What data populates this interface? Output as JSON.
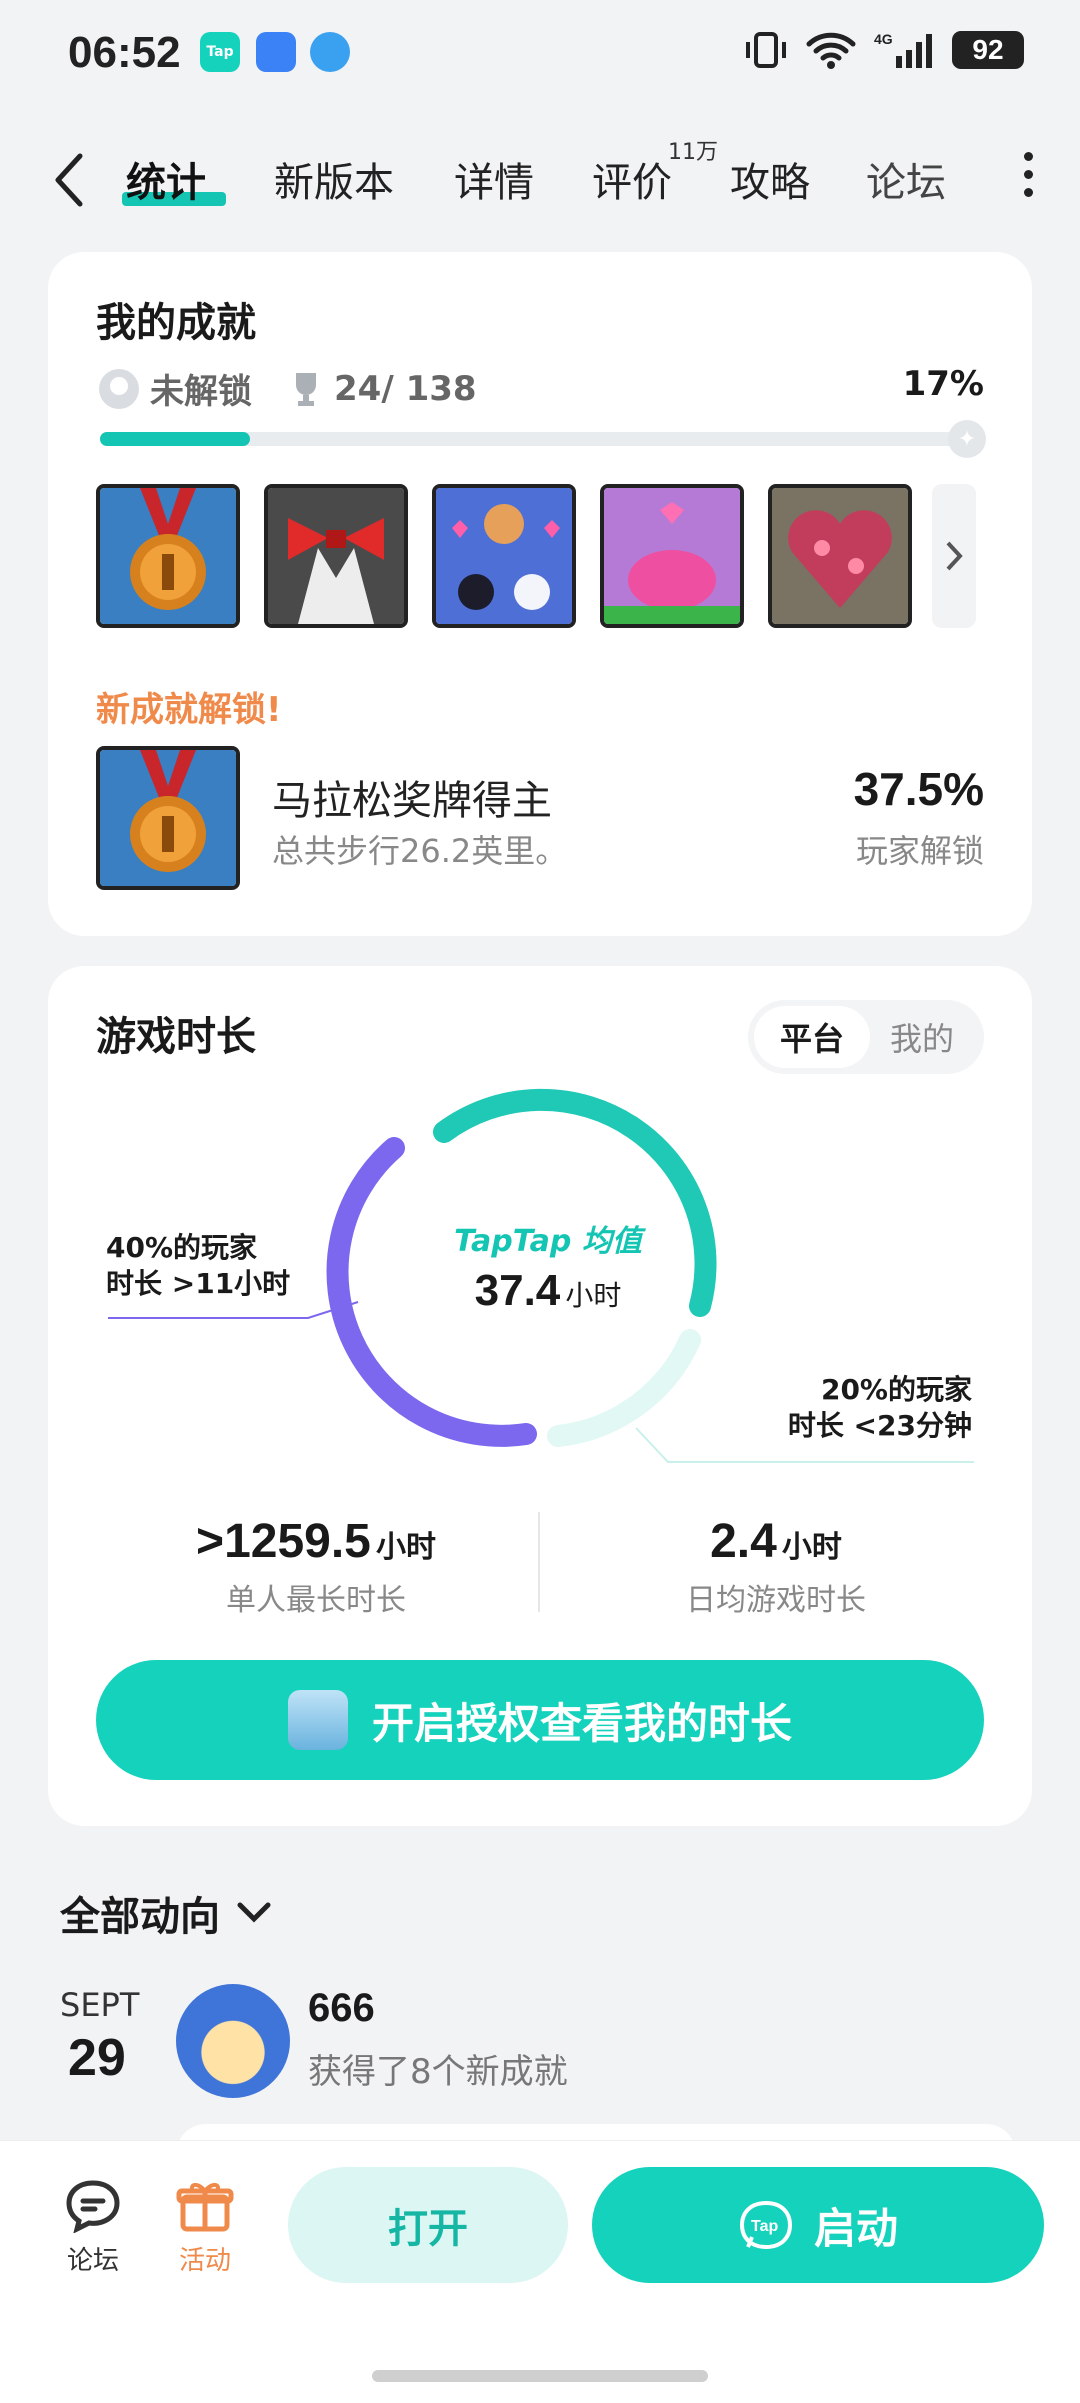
{
  "status_bar": {
    "time": "06:52",
    "battery": "92"
  },
  "tabs": {
    "items": [
      {
        "label": "统计",
        "active": true
      },
      {
        "label": "新版本"
      },
      {
        "label": "详情"
      },
      {
        "label": "评价",
        "badge": "11万"
      },
      {
        "label": "攻略"
      },
      {
        "label": "论坛"
      }
    ]
  },
  "achievements": {
    "title": "我的成就",
    "locked_label": "未解锁",
    "count": "24/ 138",
    "percent": "17%",
    "progress": 0.17,
    "badges": [
      "marathon-medal",
      "bowtie-tuxedo",
      "pets-hearts",
      "pink-slime",
      "crystal-heart"
    ],
    "new_label": "新成就解锁!",
    "new_name": "马拉松奖牌得主",
    "new_desc": "总共步行26.2英里。",
    "new_rate": "37.5%",
    "new_rate_label": "玩家解锁"
  },
  "playtime": {
    "title": "游戏时长",
    "seg_on": "平台",
    "seg_off": "我的",
    "brand": "TapTap 均值",
    "avg_value": "37.4",
    "avg_unit": "小时",
    "anno_left_1": "40%的玩家",
    "anno_left_2": "时长 >11小时",
    "anno_right_1": "20%的玩家",
    "anno_right_2": "时长 <23分钟",
    "max_value": ">1259.5",
    "max_unit": "小时",
    "max_label": "单人最长时长",
    "daily_value": "2.4",
    "daily_unit": "小时",
    "daily_label": "日均游戏时长",
    "auth_button": "开启授权查看我的时长"
  },
  "feed": {
    "title": "全部动向",
    "month": "SEPT",
    "day": "29",
    "user": "666",
    "desc": "获得了8个新成就"
  },
  "bottom": {
    "forum": "论坛",
    "activity": "活动",
    "open": "打开",
    "start": "启动"
  },
  "colors": {
    "accent": "#15c5b3",
    "orange": "#f08a4b",
    "purple": "#7b68ee"
  }
}
